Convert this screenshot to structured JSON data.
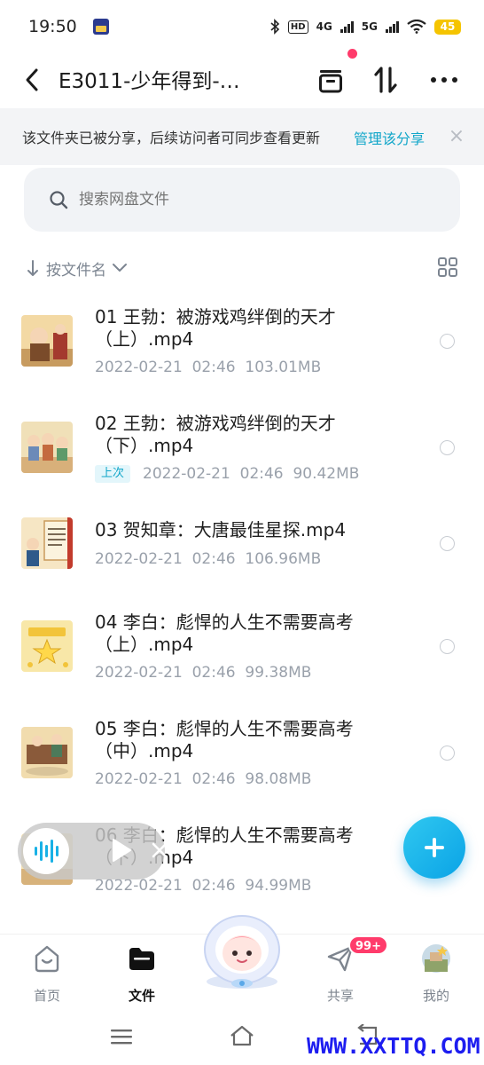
{
  "status_bar": {
    "time": "19:50",
    "battery": "45",
    "network_5g_label": "5G",
    "network_4g_label": "4G",
    "hd_label": "HD"
  },
  "header": {
    "title": "E3011-少年得到-…",
    "back_icon": "back-arrow-icon",
    "icons": [
      "archive-icon",
      "sort-transfer-icon",
      "more-icon"
    ]
  },
  "share_banner": {
    "text": "该文件夹已被分享，后续访问者可同步查看更新",
    "manage_label": "管理该分享",
    "close_label": "×"
  },
  "search": {
    "placeholder": "搜索网盘文件"
  },
  "sort": {
    "label": "按文件名"
  },
  "files": [
    {
      "name": "01 王勃：被游戏鸡绊倒的天才（上）.mp4",
      "date": "2022-02-21",
      "time": "02:46",
      "size": "103.01MB",
      "badge": ""
    },
    {
      "name": "02 王勃：被游戏鸡绊倒的天才（下）.mp4",
      "date": "2022-02-21",
      "time": "02:46",
      "size": "90.42MB",
      "badge": "上次"
    },
    {
      "name": "03 贺知章：大唐最佳星探.mp4",
      "date": "2022-02-21",
      "time": "02:46",
      "size": "106.96MB",
      "badge": ""
    },
    {
      "name": "04 李白：彪悍的人生不需要高考（上）.mp4",
      "date": "2022-02-21",
      "time": "02:46",
      "size": "99.38MB",
      "badge": ""
    },
    {
      "name": "05 李白：彪悍的人生不需要高考（中）.mp4",
      "date": "2022-02-21",
      "time": "02:46",
      "size": "98.08MB",
      "badge": ""
    },
    {
      "name": "06 李白：彪悍的人生不需要高考（下）.mp4",
      "date": "2022-02-21",
      "time": "02:46",
      "size": "94.99MB",
      "badge": ""
    }
  ],
  "bottom_nav": {
    "items": [
      {
        "label": "首页",
        "icon": "home-icon"
      },
      {
        "label": "文件",
        "icon": "folder-icon"
      },
      {
        "label": "共享",
        "icon": "send-icon"
      },
      {
        "label": "我的",
        "icon": "avatar-icon"
      }
    ],
    "share_badge": "99+"
  },
  "watermark": "WWW.XXTTQ.COM",
  "colors": {
    "accent": "#11a6c9",
    "fab": "#0aa3e6",
    "badge_red": "#ff3b6b"
  }
}
